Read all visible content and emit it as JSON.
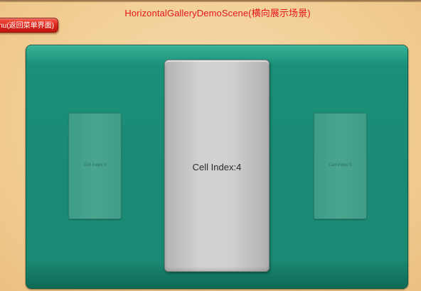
{
  "scene": {
    "title": "HorizontalGalleryDemoScene(横向展示场景)"
  },
  "back_button": {
    "label": "nu(返回菜单界面)"
  },
  "gallery": {
    "cells": [
      {
        "label": "Cell Index:3",
        "state": "side"
      },
      {
        "label": "Cell Index:4",
        "state": "selected"
      },
      {
        "label": "Cell Index:5",
        "state": "side"
      }
    ]
  },
  "colors": {
    "title": "#e8141c",
    "button": "#df2a20",
    "panel": "#1a8a74",
    "selected_cell": "#cfcfcf",
    "background": "#f2cf97"
  }
}
